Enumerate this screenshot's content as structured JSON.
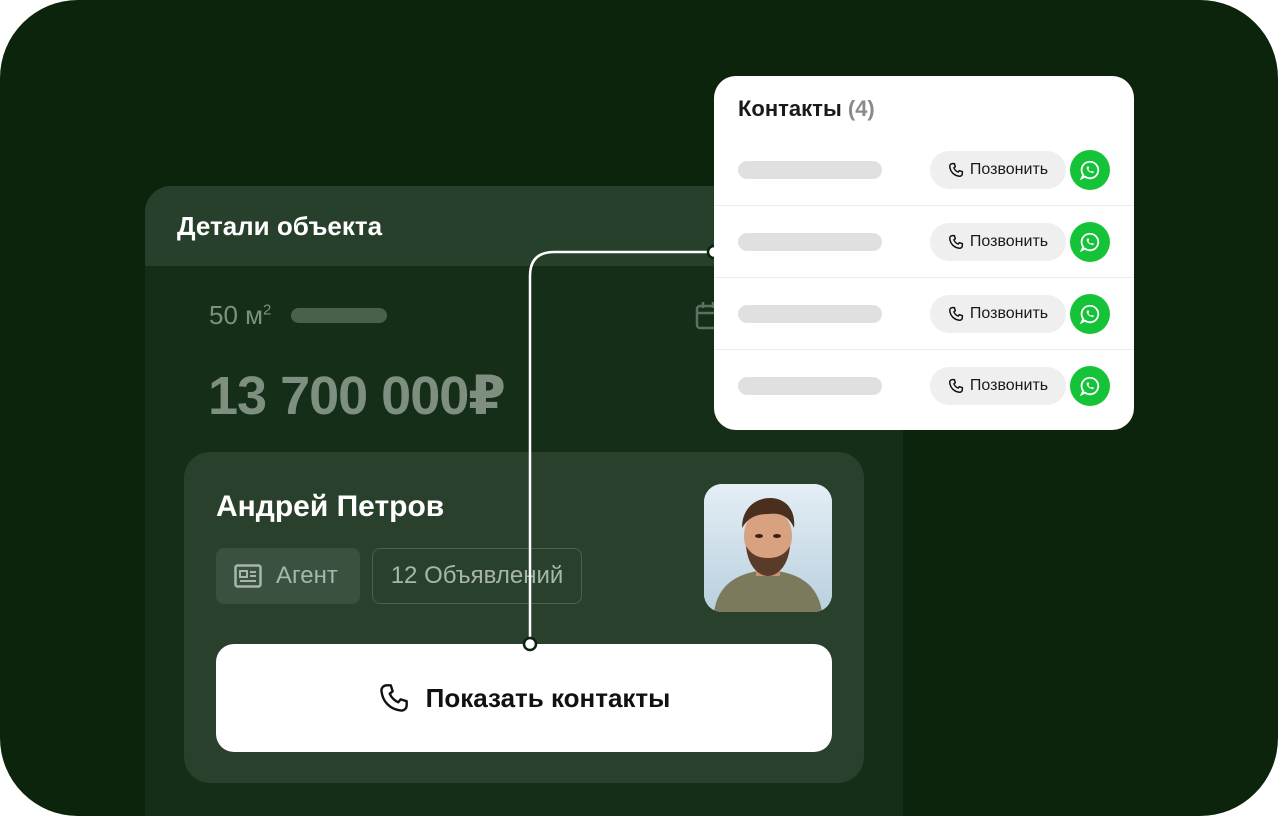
{
  "details": {
    "title": "Детали объекта",
    "area_value": "50 м",
    "area_sup": "2",
    "price": "13 700 000₽"
  },
  "agent": {
    "name": "Андрей Петров",
    "role_chip": "Агент",
    "listings_chip": "12 Объявлений",
    "show_contacts_label": "Показать контакты"
  },
  "contacts": {
    "title": "Контакты",
    "count": "(4)",
    "rows": [
      {
        "call_label": "Позвонить"
      },
      {
        "call_label": "Позвонить"
      },
      {
        "call_label": "Позвонить"
      },
      {
        "call_label": "Позвонить"
      }
    ]
  },
  "colors": {
    "background": "#0c230c",
    "card_header": "#27402b",
    "agent_card": "#29412c",
    "whatsapp_green": "#15c339"
  },
  "icons": [
    "calendar-icon",
    "id-card-icon",
    "phone-icon",
    "whatsapp-icon"
  ]
}
